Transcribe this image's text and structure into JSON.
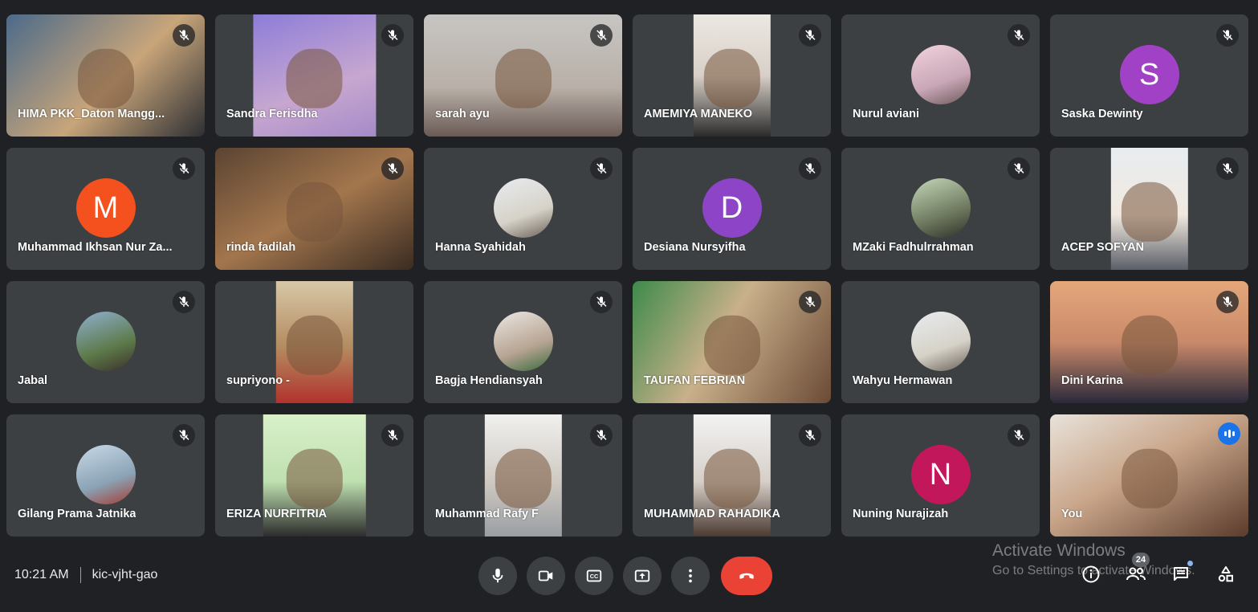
{
  "meeting": {
    "time": "10:21 AM",
    "code": "kic-vjht-gao",
    "participants_count": "24"
  },
  "watermark": {
    "line1": "Activate Windows",
    "line2": "Go to Settings to activate Windows."
  },
  "tiles": [
    {
      "name": "HIMA PKK_Daton Mangg...",
      "type": "video"
    },
    {
      "name": "Sandra Ferisdha",
      "type": "video"
    },
    {
      "name": "sarah ayu",
      "type": "video"
    },
    {
      "name": "AMEMIYA MANEKO",
      "type": "video"
    },
    {
      "name": "Nurul aviani",
      "type": "photo"
    },
    {
      "name": "Saska Dewinty",
      "type": "letter",
      "letter": "S",
      "color": "#a142c6"
    },
    {
      "name": "Muhammad Ikhsan Nur Za...",
      "type": "letter",
      "letter": "M",
      "color": "#f4511e"
    },
    {
      "name": "rinda fadilah",
      "type": "video"
    },
    {
      "name": "Hanna Syahidah",
      "type": "photo"
    },
    {
      "name": "Desiana Nursyifha",
      "type": "letter",
      "letter": "D",
      "color": "#8e44c6"
    },
    {
      "name": "MZaki Fadhulrrahman",
      "type": "photo"
    },
    {
      "name": "ACEP SOFYAN",
      "type": "video"
    },
    {
      "name": "Jabal",
      "type": "photo"
    },
    {
      "name": "supriyono -",
      "type": "video"
    },
    {
      "name": "Bagja Hendiansyah",
      "type": "photo"
    },
    {
      "name": "TAUFAN FEBRIAN",
      "type": "video"
    },
    {
      "name": "Wahyu Hermawan",
      "type": "photo"
    },
    {
      "name": "Dini Karina",
      "type": "video"
    },
    {
      "name": "Gilang Prama Jatnika",
      "type": "photo"
    },
    {
      "name": "ERIZA NURFITRIA",
      "type": "video"
    },
    {
      "name": "Muhammad Rafy F",
      "type": "video"
    },
    {
      "name": "MUHAMMAD RAHADIKA",
      "type": "video"
    },
    {
      "name": "Nuning Nurajizah",
      "type": "letter",
      "letter": "N",
      "color": "#c2185b"
    },
    {
      "name": "You",
      "type": "video",
      "speaking": true
    }
  ],
  "colors": {
    "background": "#202124",
    "tile": "#3c4043",
    "end_call": "#ea4335",
    "accent": "#8ab4f8"
  },
  "icons": {
    "tile_mute": "mic-off-icon",
    "mic": "mic-icon",
    "camera": "camera-icon",
    "captions": "captions-icon",
    "present": "present-icon",
    "more": "more-vert-icon",
    "end": "call-end-icon",
    "info": "info-icon",
    "people": "people-icon",
    "chat": "chat-icon",
    "activities": "activities-icon"
  }
}
